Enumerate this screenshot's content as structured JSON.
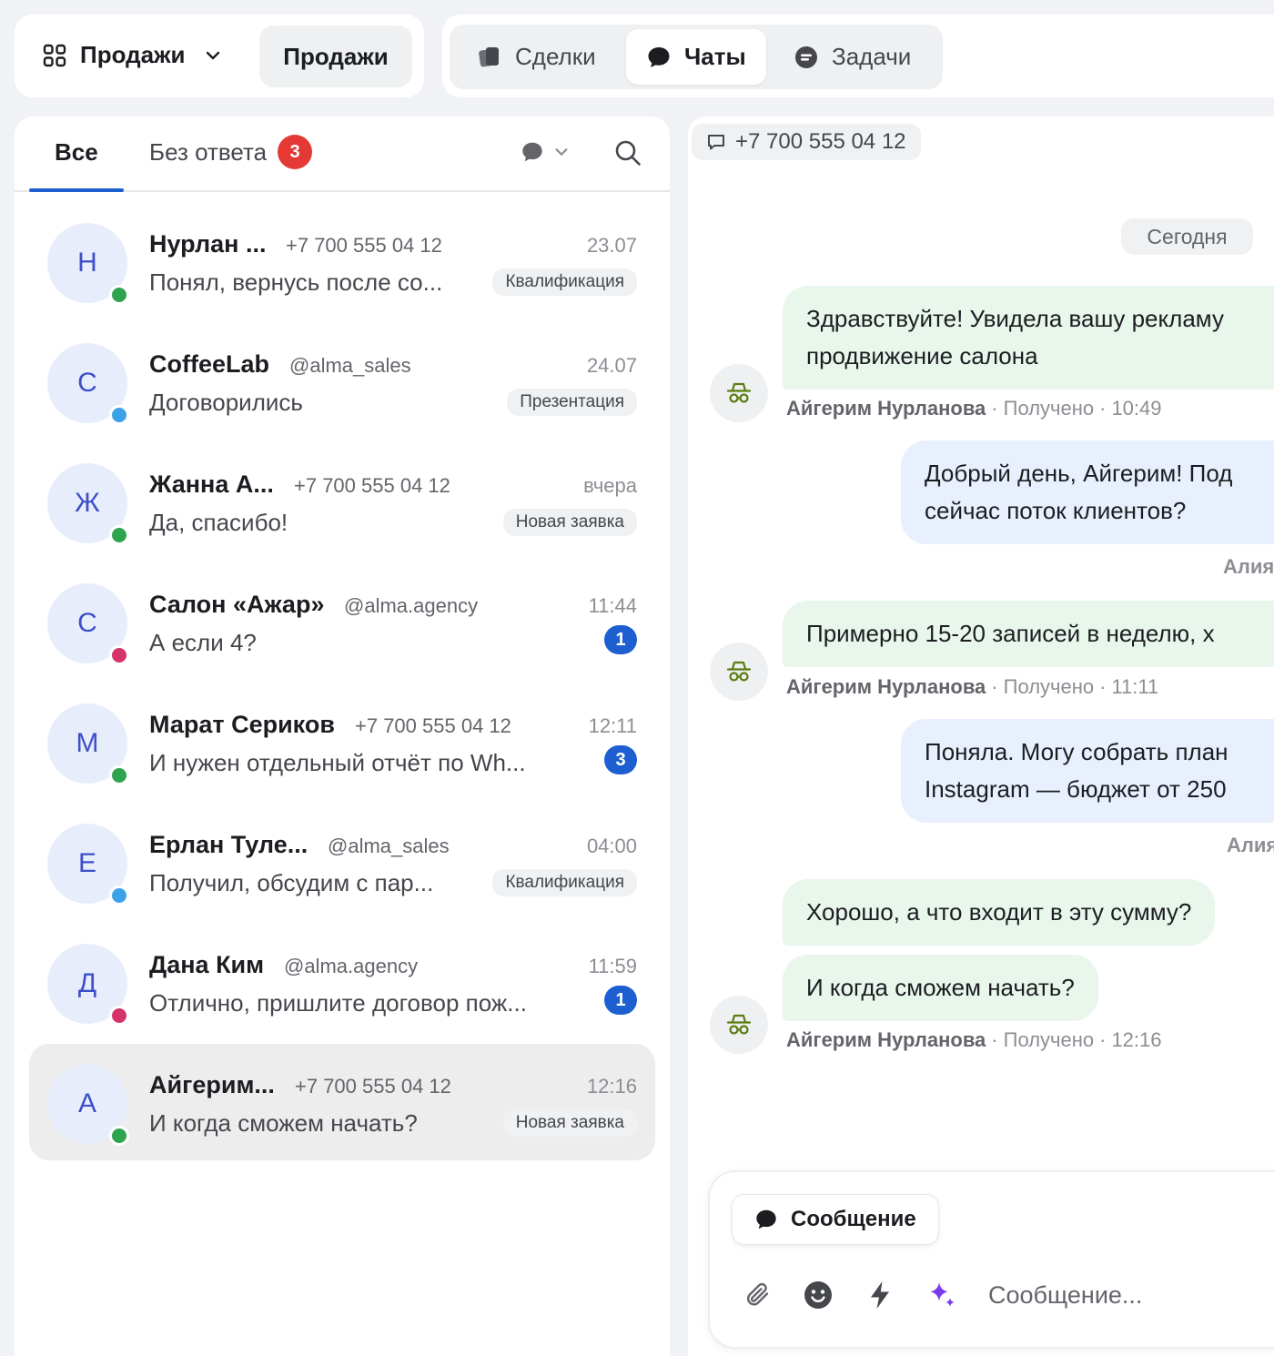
{
  "workspace": {
    "switcher_label": "Продажи",
    "pill_label": "Продажи"
  },
  "nav": {
    "tabs": [
      {
        "label": "Сделки",
        "icon": "cards-icon"
      },
      {
        "label": "Чаты",
        "icon": "chat-bubble-icon",
        "active": true
      },
      {
        "label": "Задачи",
        "icon": "task-icon"
      }
    ]
  },
  "list": {
    "tabs": {
      "all": "Все",
      "no_answer": "Без ответа",
      "no_answer_count": "3"
    },
    "chats": [
      {
        "initial": "Н",
        "name": "Нурлан ...",
        "sub": "+7 700 555 04 12",
        "time": "23.07",
        "preview": "Понял, вернусь после со...",
        "stage": "Квалификация",
        "unread": "",
        "status_color": "#2ea44f"
      },
      {
        "initial": "С",
        "name": "CoffeeLab",
        "sub": "@alma_sales",
        "time": "24.07",
        "preview": "Договорились",
        "stage": "Презентация",
        "unread": "",
        "status_color": "#3aa3e8"
      },
      {
        "initial": "Ж",
        "name": "Жанна А...",
        "sub": "+7 700 555 04 12",
        "time": "вчера",
        "preview": "Да, спасибо!",
        "stage": "Новая заявка",
        "unread": "",
        "status_color": "#2ea44f"
      },
      {
        "initial": "С",
        "name": "Салон «Ажар»",
        "sub": "@alma.agency",
        "time": "11:44",
        "preview": "А если 4?",
        "stage": "",
        "unread": "1",
        "status_color": "#d6336c"
      },
      {
        "initial": "М",
        "name": "Марат Сериков",
        "sub": "+7 700 555 04 12",
        "time": "12:11",
        "preview": "И нужен отдельный отчёт по Wh...",
        "stage": "",
        "unread": "3",
        "status_color": "#2ea44f"
      },
      {
        "initial": "Е",
        "name": "Ерлан Туле...",
        "sub": "@alma_sales",
        "time": "04:00",
        "preview": "Получил, обсудим с пар...",
        "stage": "Квалификация",
        "unread": "",
        "status_color": "#3aa3e8"
      },
      {
        "initial": "Д",
        "name": "Дана Ким",
        "sub": "@alma.agency",
        "time": "11:59",
        "preview": "Отлично, пришлите договор пож...",
        "stage": "",
        "unread": "1",
        "status_color": "#d6336c"
      },
      {
        "initial": "А",
        "name": "Айгерим...",
        "sub": "+7 700 555 04 12",
        "time": "12:16",
        "preview": "И когда сможем начать?",
        "stage": "Новая заявка",
        "unread": "",
        "status_color": "#2ea44f",
        "selected": true
      }
    ]
  },
  "conversation": {
    "phone": "+7 700 555 04 12",
    "date_label": "Сегодня",
    "messages": [
      {
        "dir": "in",
        "lines": [
          "Здравствуйте! Увидела вашу рекламу",
          "продвижение салона"
        ]
      },
      {
        "dir": "in_meta",
        "author": "Айгерим Нурланова",
        "status": "Получено",
        "time": "10:49"
      },
      {
        "dir": "out",
        "lines": [
          "Добрый день, Айгерим! Под",
          "сейчас поток клиентов?"
        ]
      },
      {
        "dir": "out_meta",
        "author": "Алия"
      },
      {
        "dir": "in",
        "lines": [
          "Примерно 15-20 записей в неделю, х"
        ]
      },
      {
        "dir": "in_meta",
        "author": "Айгерим Нурланова",
        "status": "Получено",
        "time": "11:11"
      },
      {
        "dir": "out",
        "lines": [
          "Поняла. Могу собрать план",
          "Instagram — бюджет от 250"
        ]
      },
      {
        "dir": "out_meta",
        "author": "Алия"
      },
      {
        "dir": "in",
        "lines": [
          "Хорошо, а что входит в эту сумму?"
        ]
      },
      {
        "dir": "in",
        "lines": [
          "И когда сможем начать?"
        ]
      },
      {
        "dir": "in_meta",
        "author": "Айгерим Нурланова",
        "status": "Получено",
        "time": "12:16"
      }
    ]
  },
  "composer": {
    "mode_label": "Сообщение",
    "placeholder": "Сообщение..."
  },
  "colors": {
    "accent": "#1d5fd1",
    "badge_red": "#e53935",
    "incoming_bubble": "#e9f6ec",
    "outgoing_bubble": "#e7f0fc",
    "bot_icon": "#5a7d10",
    "ai_sparkle": "#7c3aed"
  }
}
